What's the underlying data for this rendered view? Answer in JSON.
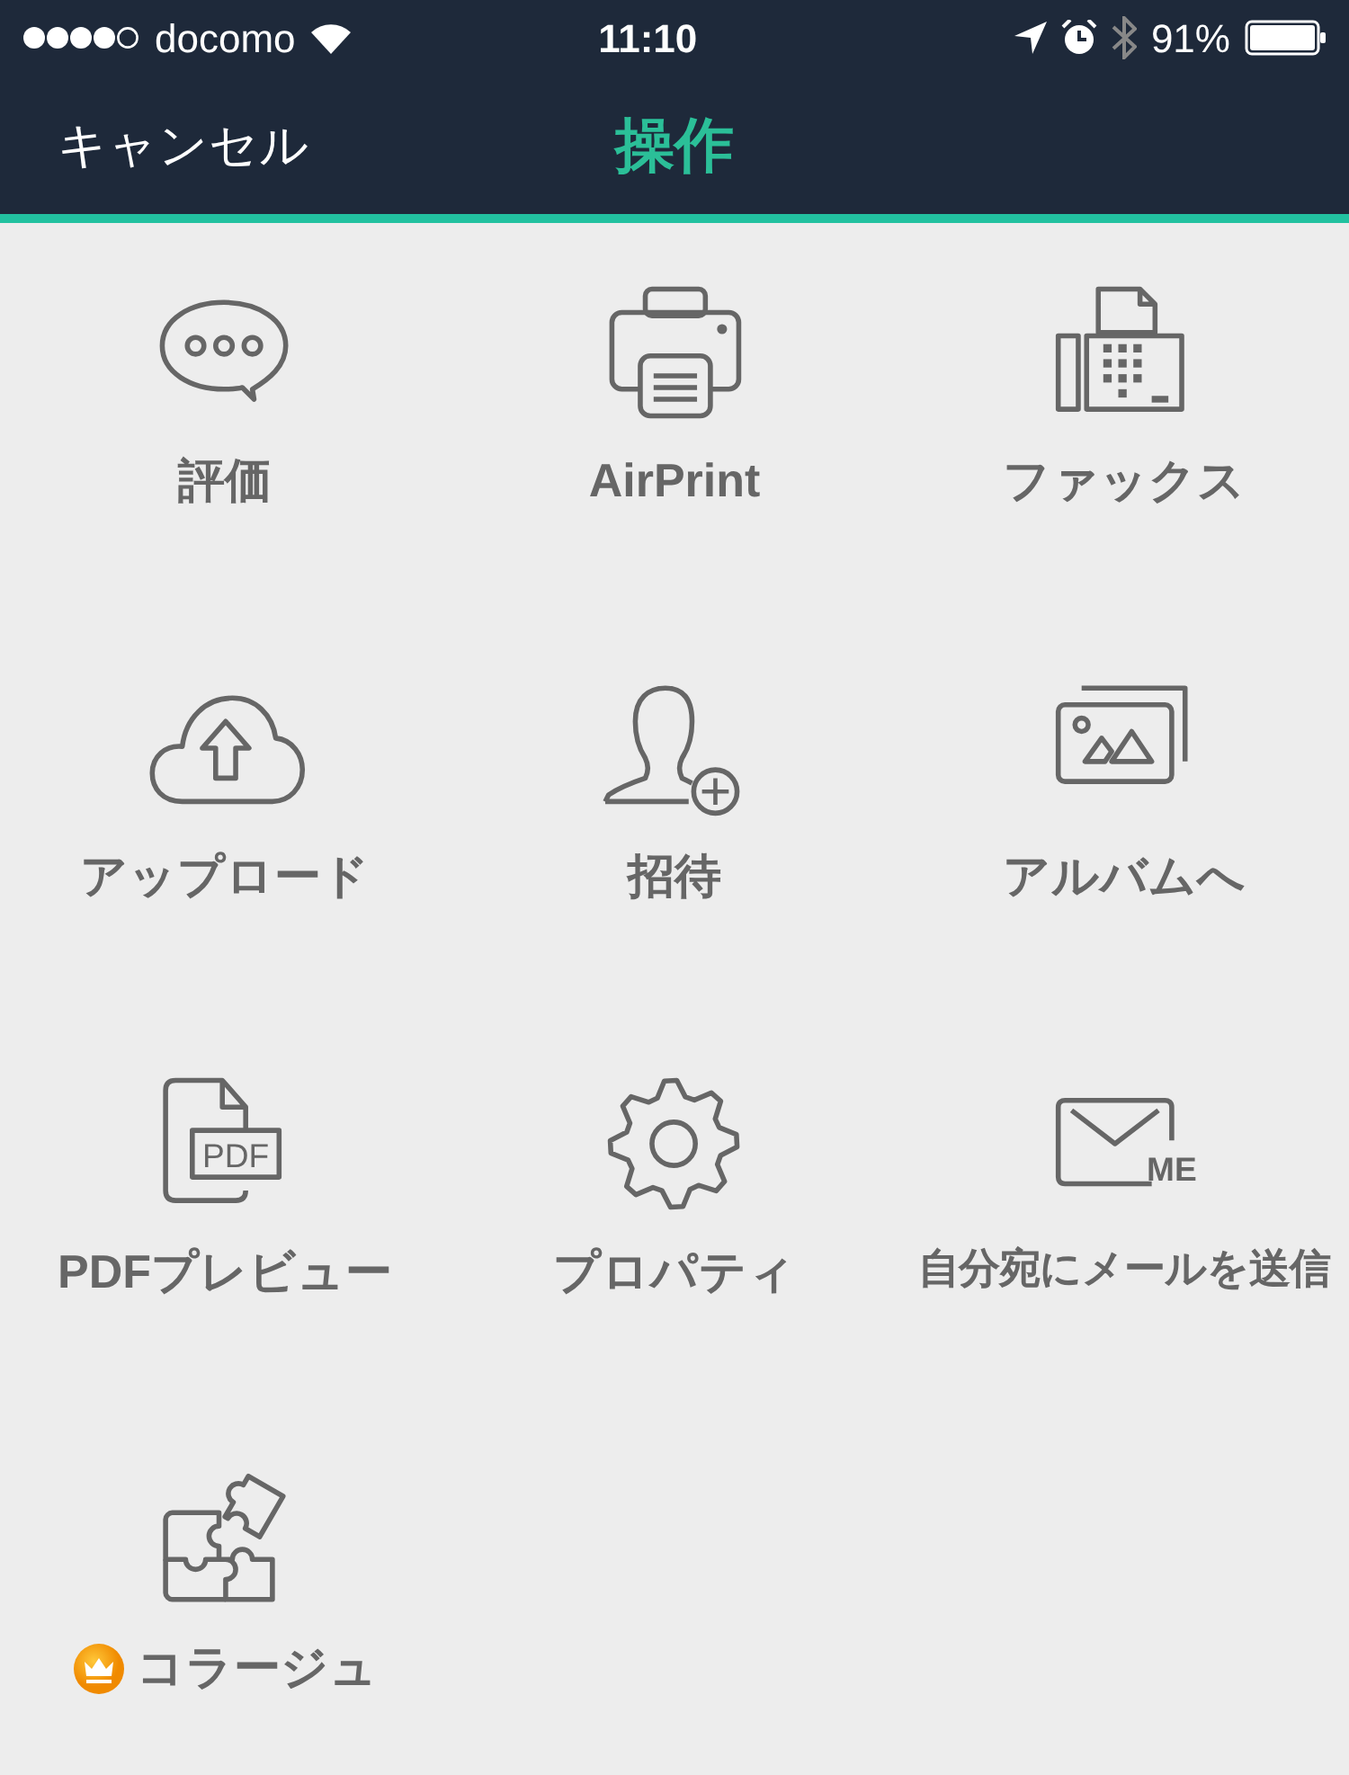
{
  "status_bar": {
    "carrier": "docomo",
    "time": "11:10",
    "battery": "91%"
  },
  "nav_bar": {
    "cancel": "キャンセル",
    "title": "操作"
  },
  "actions": [
    {
      "kind": "chat",
      "label": "評価",
      "premium": false
    },
    {
      "kind": "printer",
      "label": "AirPrint",
      "premium": false
    },
    {
      "kind": "fax",
      "label": "ファックス",
      "premium": false
    },
    {
      "kind": "upload",
      "label": "アップロード",
      "premium": false
    },
    {
      "kind": "invite",
      "label": "招待",
      "premium": false
    },
    {
      "kind": "album",
      "label": "アルバムへ",
      "premium": false
    },
    {
      "kind": "pdf",
      "icon_text": "PDF",
      "label": "PDFプレビュー",
      "premium": false
    },
    {
      "kind": "gear",
      "label": "プロパティ",
      "premium": false
    },
    {
      "kind": "mail",
      "icon_text": "ME",
      "label": "自分宛にメールを送信",
      "premium": false
    },
    {
      "kind": "puzzle",
      "label": "コラージュ",
      "premium": true
    }
  ]
}
